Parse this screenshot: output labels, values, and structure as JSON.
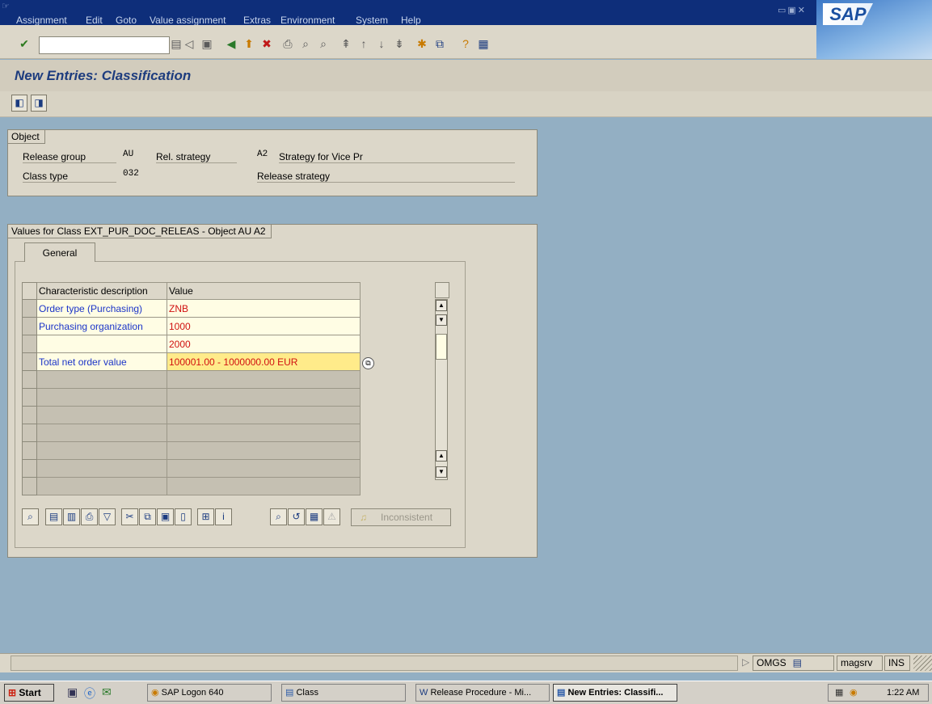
{
  "menu": [
    "Assignment",
    "Edit",
    "Goto",
    "Value assignment",
    "Extras",
    "Environment",
    "System",
    "Help"
  ],
  "brand": "SAP",
  "window_title": "New Entries: Classification",
  "object_frame": {
    "title": "Object",
    "release_group_label": "Release group",
    "release_group_value": "AU",
    "rel_strategy_label": "Rel. strategy",
    "rel_strategy_value": "A2",
    "rel_strategy_desc": "Strategy for Vice Pr",
    "class_type_label": "Class type",
    "class_type_value": "032",
    "class_type_desc": "Release strategy"
  },
  "values_frame": {
    "title": "Values for Class EXT_PUR_DOC_RELEAS - Object AU A2",
    "tab": "General",
    "columns": [
      "Characteristic description",
      "Value"
    ],
    "rows": [
      {
        "desc": "Order type (Purchasing)",
        "value": "ZNB"
      },
      {
        "desc": "Purchasing organization",
        "value": "1000"
      },
      {
        "desc": "",
        "value": "2000"
      },
      {
        "desc": "Total net order value",
        "value": "100001.00 - 1000000.00 EUR"
      }
    ],
    "inconsistent_label": "Inconsistent"
  },
  "status": {
    "system": "OMGS",
    "server": "magsrv",
    "mode": "INS"
  },
  "taskbar": {
    "start": "Start",
    "tasks": [
      "SAP Logon 640",
      "Class",
      "Release Procedure - Mi...",
      "New Entries: Classifi..."
    ],
    "clock": "1:22 AM"
  }
}
